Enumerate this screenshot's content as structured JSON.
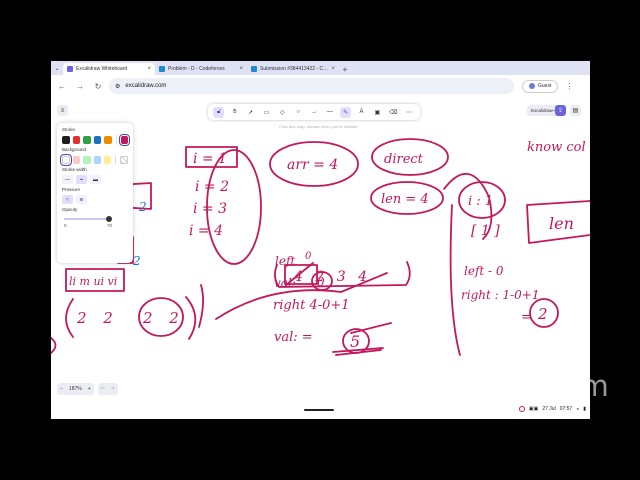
{
  "browser": {
    "tabs": [
      {
        "label": "Excalidraw Whiteboard",
        "active": true,
        "color": "#6965db"
      },
      {
        "label": "Problem - D - Codeforces",
        "active": false,
        "color": "#1f8acb"
      },
      {
        "label": "Submission #384413422 - Cod",
        "active": false,
        "color": "#1f8acb"
      }
    ],
    "address": "excalidraw.com",
    "guest_label": "Guest"
  },
  "excalidraw": {
    "toolbar_hint": "Click and drag, release when you're finished",
    "share_label": "Excalidraw+",
    "properties": {
      "stroke_label": "Stroke",
      "stroke_colors": [
        "#1e1e1e",
        "#e03131",
        "#2f9e44",
        "#1971c2",
        "#f08c00"
      ],
      "stroke_current": "#c2185b",
      "background_label": "Background",
      "background_colors": [
        "#ffffff",
        "#ffc9c9",
        "#b2f2bb",
        "#a5d8ff",
        "#ffec99"
      ],
      "stroke_width_label": "Stroke width",
      "pressure_label": "Pressure",
      "opacity_label": "Opacity",
      "opacity_min": "0",
      "opacity_max": "70",
      "opacity_value": 70
    },
    "zoom": "187%"
  },
  "system": {
    "date": "27 Jul",
    "time": "07:57"
  },
  "ink": {
    "i1": "i = 1",
    "i2": "i = 2",
    "i3": "i = 3",
    "i4": "i = 4",
    "arr": "arr = 4",
    "direct": "direct",
    "len4": "len = 4",
    "len_partial": "len",
    "know_cols": "know col",
    "arr_vals": "4 2 3 4",
    "zero_label": "0",
    "left_label": "left",
    "val_label": "val:",
    "zero_circle": "0",
    "right_calc": "right 4-0+1",
    "val2": "val: =",
    "five": "5",
    "i1_right": "i : 1",
    "one_box": "[ 1 ]",
    "left0": "left - 0",
    "right_calc2": "right : 1-0+1",
    "eq2": "=",
    "two": "2",
    "li_label": "li  m  ui  vi",
    "pair1": "2 2",
    "pair2": "2 2",
    "edge_2a": "2",
    "edge_2b": "2"
  },
  "watermark": "clideo.com"
}
